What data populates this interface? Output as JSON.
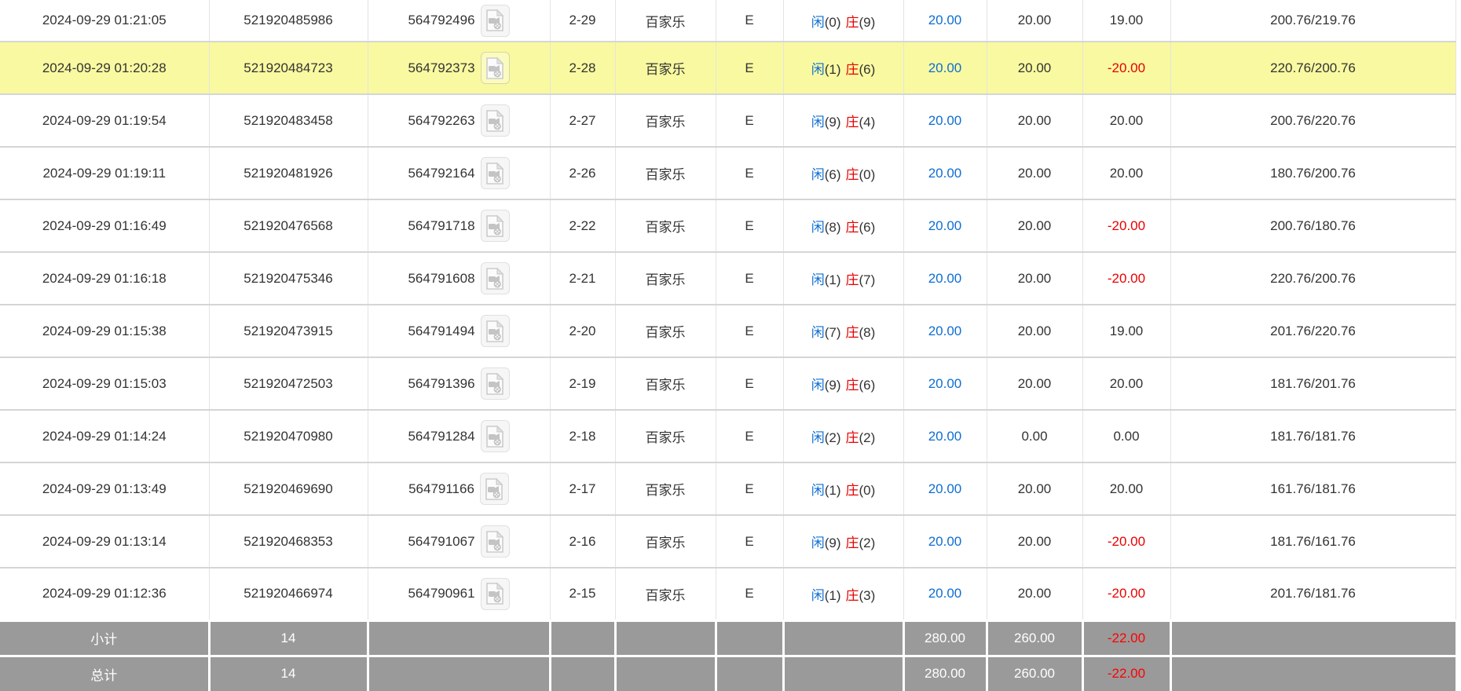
{
  "labels": {
    "player": "闲",
    "banker": "庄"
  },
  "colors": {
    "link_blue": "#0e6ed2",
    "negative_red": "#e80000",
    "highlight_yellow": "#f9f9a1",
    "summary_gray": "#9a9a9a"
  },
  "icons": {
    "video": "video-file-icon"
  },
  "rows": [
    {
      "time": "2024-09-29 01:21:05",
      "order_id": "521920485986",
      "round_id": "564792496",
      "round_no": "2-29",
      "game": "百家乐",
      "table_code": "E",
      "result_player": "0",
      "result_banker": "9",
      "bet_amount": "20.00",
      "valid_amount": "20.00",
      "win_loss": "19.00",
      "balance": "200.76/219.76",
      "highlighted": false
    },
    {
      "time": "2024-09-29 01:20:28",
      "order_id": "521920484723",
      "round_id": "564792373",
      "round_no": "2-28",
      "game": "百家乐",
      "table_code": "E",
      "result_player": "1",
      "result_banker": "6",
      "bet_amount": "20.00",
      "valid_amount": "20.00",
      "win_loss": "-20.00",
      "balance": "220.76/200.76",
      "highlighted": true
    },
    {
      "time": "2024-09-29 01:19:54",
      "order_id": "521920483458",
      "round_id": "564792263",
      "round_no": "2-27",
      "game": "百家乐",
      "table_code": "E",
      "result_player": "9",
      "result_banker": "4",
      "bet_amount": "20.00",
      "valid_amount": "20.00",
      "win_loss": "20.00",
      "balance": "200.76/220.76",
      "highlighted": false
    },
    {
      "time": "2024-09-29 01:19:11",
      "order_id": "521920481926",
      "round_id": "564792164",
      "round_no": "2-26",
      "game": "百家乐",
      "table_code": "E",
      "result_player": "6",
      "result_banker": "0",
      "bet_amount": "20.00",
      "valid_amount": "20.00",
      "win_loss": "20.00",
      "balance": "180.76/200.76",
      "highlighted": false
    },
    {
      "time": "2024-09-29 01:16:49",
      "order_id": "521920476568",
      "round_id": "564791718",
      "round_no": "2-22",
      "game": "百家乐",
      "table_code": "E",
      "result_player": "8",
      "result_banker": "6",
      "bet_amount": "20.00",
      "valid_amount": "20.00",
      "win_loss": "-20.00",
      "balance": "200.76/180.76",
      "highlighted": false
    },
    {
      "time": "2024-09-29 01:16:18",
      "order_id": "521920475346",
      "round_id": "564791608",
      "round_no": "2-21",
      "game": "百家乐",
      "table_code": "E",
      "result_player": "1",
      "result_banker": "7",
      "bet_amount": "20.00",
      "valid_amount": "20.00",
      "win_loss": "-20.00",
      "balance": "220.76/200.76",
      "highlighted": false
    },
    {
      "time": "2024-09-29 01:15:38",
      "order_id": "521920473915",
      "round_id": "564791494",
      "round_no": "2-20",
      "game": "百家乐",
      "table_code": "E",
      "result_player": "7",
      "result_banker": "8",
      "bet_amount": "20.00",
      "valid_amount": "20.00",
      "win_loss": "19.00",
      "balance": "201.76/220.76",
      "highlighted": false
    },
    {
      "time": "2024-09-29 01:15:03",
      "order_id": "521920472503",
      "round_id": "564791396",
      "round_no": "2-19",
      "game": "百家乐",
      "table_code": "E",
      "result_player": "9",
      "result_banker": "6",
      "bet_amount": "20.00",
      "valid_amount": "20.00",
      "win_loss": "20.00",
      "balance": "181.76/201.76",
      "highlighted": false
    },
    {
      "time": "2024-09-29 01:14:24",
      "order_id": "521920470980",
      "round_id": "564791284",
      "round_no": "2-18",
      "game": "百家乐",
      "table_code": "E",
      "result_player": "2",
      "result_banker": "2",
      "bet_amount": "20.00",
      "valid_amount": "0.00",
      "win_loss": "0.00",
      "balance": "181.76/181.76",
      "highlighted": false
    },
    {
      "time": "2024-09-29 01:13:49",
      "order_id": "521920469690",
      "round_id": "564791166",
      "round_no": "2-17",
      "game": "百家乐",
      "table_code": "E",
      "result_player": "1",
      "result_banker": "0",
      "bet_amount": "20.00",
      "valid_amount": "20.00",
      "win_loss": "20.00",
      "balance": "161.76/181.76",
      "highlighted": false
    },
    {
      "time": "2024-09-29 01:13:14",
      "order_id": "521920468353",
      "round_id": "564791067",
      "round_no": "2-16",
      "game": "百家乐",
      "table_code": "E",
      "result_player": "9",
      "result_banker": "2",
      "bet_amount": "20.00",
      "valid_amount": "20.00",
      "win_loss": "-20.00",
      "balance": "181.76/161.76",
      "highlighted": false
    },
    {
      "time": "2024-09-29 01:12:36",
      "order_id": "521920466974",
      "round_id": "564790961",
      "round_no": "2-15",
      "game": "百家乐",
      "table_code": "E",
      "result_player": "1",
      "result_banker": "3",
      "bet_amount": "20.00",
      "valid_amount": "20.00",
      "win_loss": "-20.00",
      "balance": "201.76/181.76",
      "highlighted": false
    }
  ],
  "footer": {
    "subtotal": {
      "label": "小计",
      "count": "14",
      "bet": "280.00",
      "valid": "260.00",
      "win_loss": "-22.00"
    },
    "total": {
      "label": "总计",
      "count": "14",
      "bet": "280.00",
      "valid": "260.00",
      "win_loss": "-22.00"
    }
  }
}
